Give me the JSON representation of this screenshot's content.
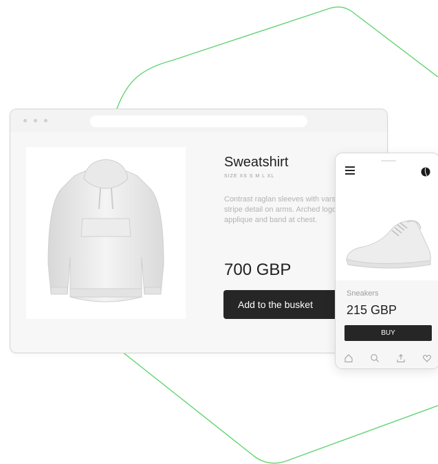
{
  "colors": {
    "accent_line": "#5fd36f",
    "button_dark": "#262626",
    "page_background": "#ffffff"
  },
  "browser": {
    "window_dots": [
      "dot",
      "dot",
      "dot"
    ],
    "address_bar": ""
  },
  "product": {
    "title": "Sweatshirt",
    "sizes": "SIZE  XS  S  M  L XL",
    "description": "Contrast raglan sleeves with varsity stripe detail on arms. Arched logo applique and band at chest.",
    "price": "700 GBP",
    "add_button_label": "Add to the busket",
    "image_icon": "hoodie-image"
  },
  "mobile": {
    "menu_icon": "hamburger-icon",
    "profile_icon": "profile-icon",
    "image_icon": "sneaker-image",
    "product_name": "Sneakers",
    "price": "215 GBP",
    "buy_label": "BUY",
    "tabs": [
      "home-icon",
      "search-icon",
      "share-icon",
      "heart-icon"
    ]
  }
}
